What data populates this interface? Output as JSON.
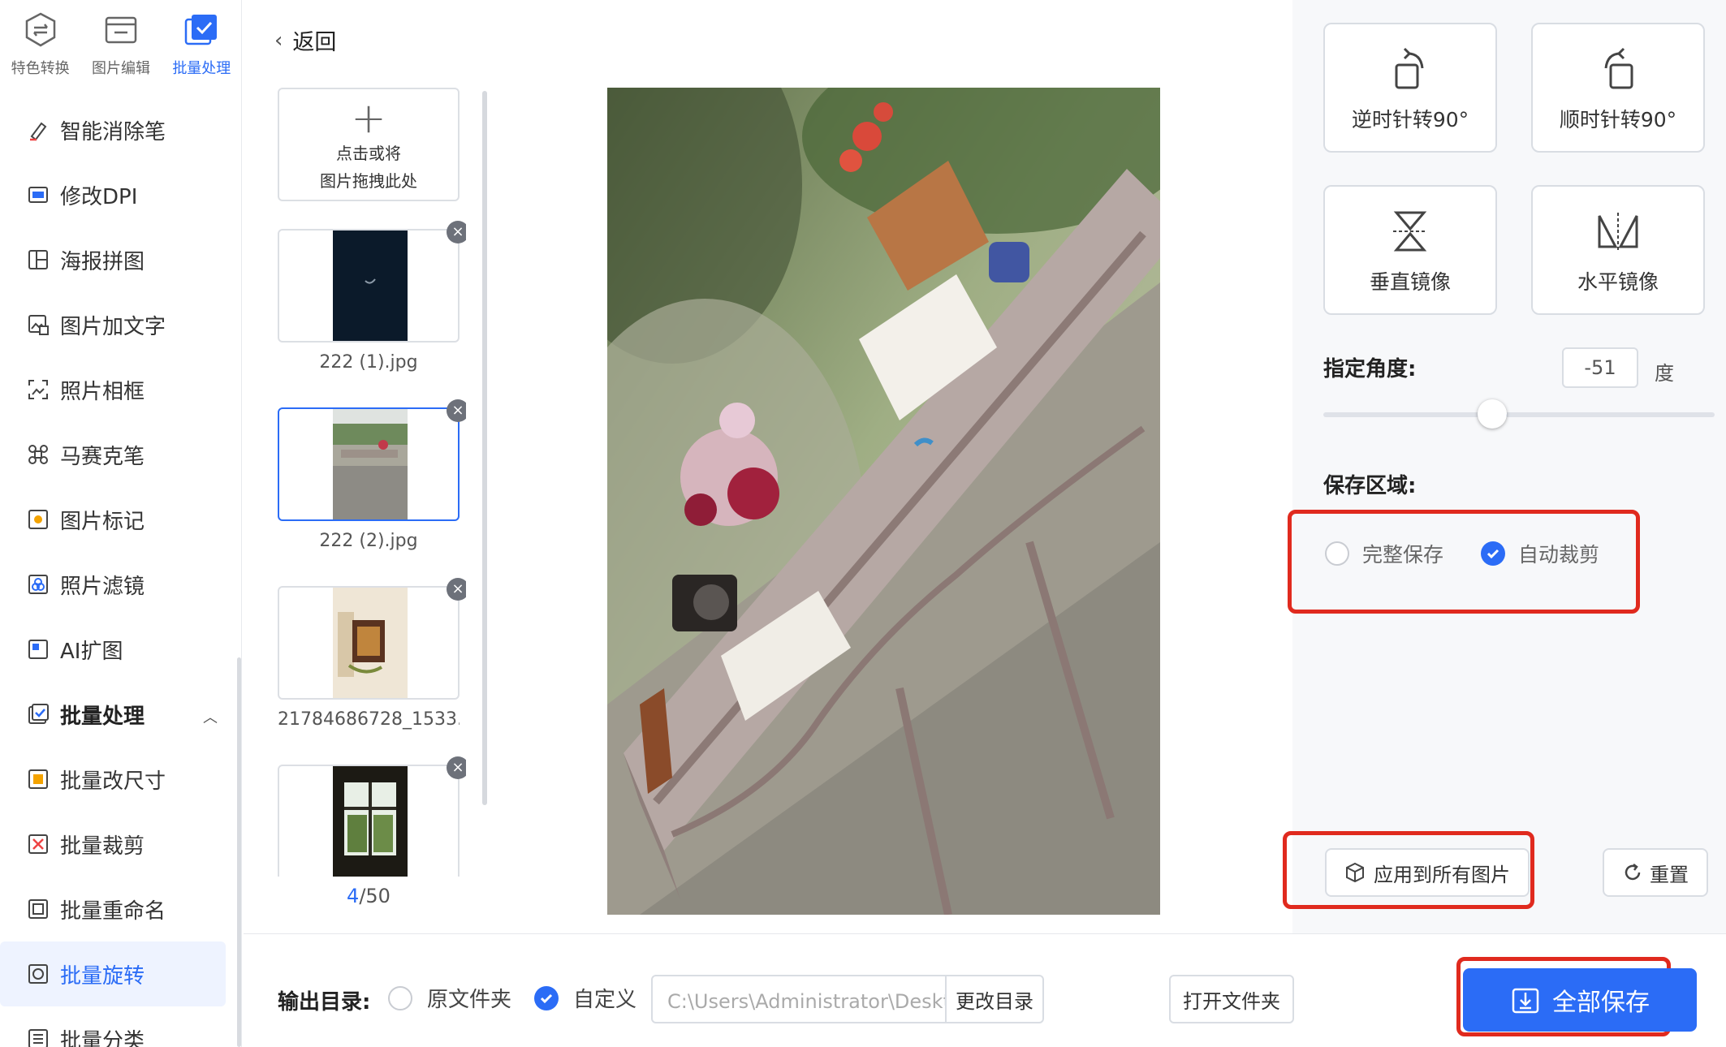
{
  "top_tabs": [
    {
      "label": "特色转换",
      "icon": "convert-icon"
    },
    {
      "label": "图片编辑",
      "icon": "image-edit-icon"
    },
    {
      "label": "批量处理",
      "icon": "batch-icon"
    }
  ],
  "sidebar": {
    "items": [
      {
        "label": "智能消除笔",
        "icon": "eraser-pen-icon"
      },
      {
        "label": "修改DPI",
        "icon": "dpi-icon"
      },
      {
        "label": "海报拼图",
        "icon": "collage-icon"
      },
      {
        "label": "图片加文字",
        "icon": "image-text-icon"
      },
      {
        "label": "照片相框",
        "icon": "photo-frame-icon"
      },
      {
        "label": "马赛克笔",
        "icon": "mosaic-icon"
      },
      {
        "label": "图片标记",
        "icon": "mark-icon"
      },
      {
        "label": "照片滤镜",
        "icon": "filter-icon"
      },
      {
        "label": "AI扩图",
        "icon": "ai-expand-icon"
      },
      {
        "label": "批量处理",
        "icon": "batch-icon"
      },
      {
        "label": "批量改尺寸",
        "icon": "resize-icon"
      },
      {
        "label": "批量裁剪",
        "icon": "crop-icon"
      },
      {
        "label": "批量重命名",
        "icon": "rename-icon"
      },
      {
        "label": "批量旋转",
        "icon": "rotate-icon"
      },
      {
        "label": "批量分类",
        "icon": "classify-icon"
      }
    ]
  },
  "thumbs": {
    "back_label": "返回",
    "add_line1": "点击或将",
    "add_line2": "图片拖拽此处",
    "files": [
      "222 (1).jpg",
      "222 (2).jpg",
      "21784686728_1533...",
      ""
    ],
    "close_glyph": "×",
    "pager_current": "4",
    "pager_total": "/50"
  },
  "rotate": {
    "ccw_label": "逆时针转90°",
    "cw_label": "顺时针转90°",
    "vflip_label": "垂直镜像",
    "hflip_label": "水平镜像",
    "angle_label": "指定角度:",
    "angle_value": "-51",
    "angle_unit": "度",
    "save_area_label": "保存区域:",
    "option_full": "完整保存",
    "option_autocrop": "自动裁剪",
    "selected_option": "自动裁剪",
    "apply_all_label": "应用到所有图片",
    "reset_label": "重置"
  },
  "output": {
    "label": "输出目录:",
    "option_original": "原文件夹",
    "option_custom": "自定义",
    "path": "C:\\Users\\Administrator\\Desktop\\图片",
    "change_dir_label": "更改目录",
    "open_folder_label": "打开文件夹",
    "save_all_label": "全部保存"
  },
  "colors": {
    "accent": "#2b6cf6",
    "highlight": "#e02a1e"
  }
}
